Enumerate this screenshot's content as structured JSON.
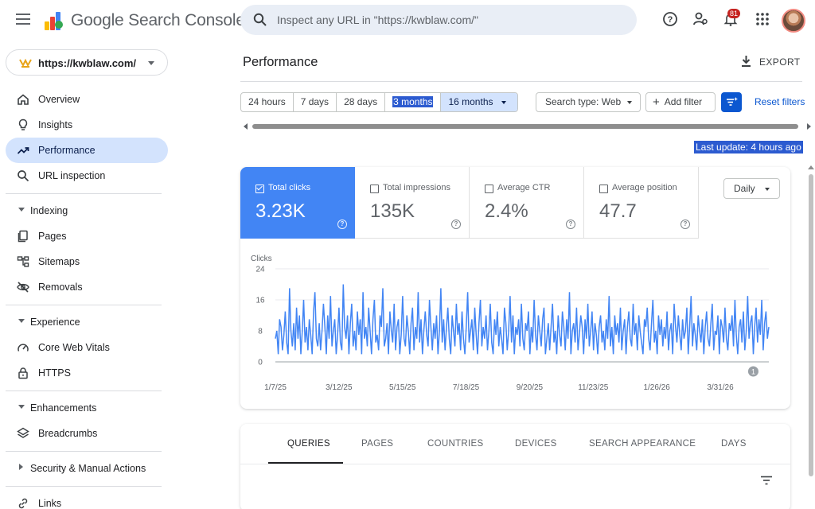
{
  "app": {
    "brand_google": "Google",
    "brand_product": "Search Console"
  },
  "search": {
    "placeholder": "Inspect any URL in \"https://kwblaw.com/\""
  },
  "header": {
    "notification_count": "81"
  },
  "property": {
    "label": "https://kwblaw.com/"
  },
  "sidebar": {
    "items": [
      {
        "label": "Overview",
        "icon": "home-icon"
      },
      {
        "label": "Insights",
        "icon": "lightbulb-icon"
      },
      {
        "label": "Performance",
        "icon": "trending-up-icon",
        "active": true
      },
      {
        "label": "URL inspection",
        "icon": "search-icon"
      }
    ],
    "sections": [
      {
        "label": "Indexing",
        "expanded": true,
        "items": [
          {
            "label": "Pages",
            "icon": "pages-icon"
          },
          {
            "label": "Sitemaps",
            "icon": "sitemap-icon"
          },
          {
            "label": "Removals",
            "icon": "eye-off-icon"
          }
        ]
      },
      {
        "label": "Experience",
        "expanded": true,
        "items": [
          {
            "label": "Core Web Vitals",
            "icon": "speedometer-icon"
          },
          {
            "label": "HTTPS",
            "icon": "lock-icon"
          }
        ]
      },
      {
        "label": "Enhancements",
        "expanded": true,
        "items": [
          {
            "label": "Breadcrumbs",
            "icon": "layers-icon"
          }
        ]
      },
      {
        "label": "Security & Manual Actions",
        "expanded": false,
        "items": []
      }
    ],
    "links": {
      "label": "Links",
      "icon": "link-icon"
    }
  },
  "main": {
    "title": "Performance",
    "export_label": "EXPORT",
    "ranges": [
      "24 hours",
      "7 days",
      "28 days",
      "3 months",
      "16 months"
    ],
    "range_selected": "16 months",
    "search_type": "Search type: Web",
    "add_filter": "Add filter",
    "reset_filters": "Reset filters",
    "last_update": "Last update: 4 hours ago"
  },
  "metrics": [
    {
      "label": "Total clicks",
      "value": "3.23K",
      "checked": true
    },
    {
      "label": "Total impressions",
      "value": "135K",
      "checked": false
    },
    {
      "label": "Average CTR",
      "value": "2.4%",
      "checked": false
    },
    {
      "label": "Average position",
      "value": "47.7",
      "checked": false
    }
  ],
  "granularity": "Daily",
  "colors": {
    "accent": "#4285f4",
    "selected_bg": "#d3e3fd",
    "link": "#0b57d0"
  },
  "chart_data": {
    "type": "line",
    "ylabel": "Clicks",
    "yticks": [
      "24",
      "16",
      "8",
      "0"
    ],
    "ylim": [
      0,
      24
    ],
    "xticks": [
      "1/7/25",
      "3/12/25",
      "5/15/25",
      "7/18/25",
      "9/20/25",
      "11/23/25",
      "1/26/26",
      "3/31/26"
    ],
    "annotation": "1",
    "series": [
      {
        "color": "#4285f4",
        "values": [
          6,
          8,
          2,
          11,
          9,
          3,
          7,
          13,
          5,
          2,
          19,
          8,
          4,
          10,
          3,
          14,
          6,
          12,
          2,
          8,
          16,
          5,
          9,
          3,
          11,
          7,
          2,
          13,
          18,
          6,
          4,
          10,
          3,
          8,
          15,
          9,
          2,
          12,
          6,
          17,
          4,
          8,
          11,
          2,
          7,
          14,
          5,
          3,
          20,
          9,
          6,
          12,
          2,
          10,
          15,
          4,
          8,
          3,
          13,
          7,
          11,
          2,
          18,
          6,
          9,
          4,
          14,
          8,
          2,
          11,
          16,
          5,
          7,
          3,
          12,
          9,
          19,
          4,
          6,
          10,
          2,
          13,
          8,
          5,
          15,
          3,
          9,
          11,
          2,
          7,
          17,
          6,
          4,
          12,
          8,
          2,
          10,
          14,
          3,
          9,
          6,
          18,
          5,
          11,
          2,
          8,
          13,
          7,
          4,
          16,
          9,
          3,
          10,
          6,
          12,
          2,
          8,
          19,
          5,
          11,
          3,
          9,
          14,
          6,
          2,
          12,
          8,
          4,
          15,
          7,
          10,
          3,
          13,
          6,
          2,
          9,
          18,
          5,
          8,
          11,
          3,
          14,
          7,
          2,
          10,
          16,
          4,
          9,
          6,
          12,
          3,
          8,
          15,
          5,
          2,
          11,
          7,
          13,
          4,
          9,
          6,
          2,
          14,
          10,
          3,
          8,
          17,
          5,
          12,
          2,
          9,
          7,
          11,
          4,
          15,
          6,
          3,
          10,
          8,
          13,
          2,
          9,
          5,
          16,
          7,
          3,
          12,
          8,
          4,
          11,
          14,
          2,
          6,
          10,
          3,
          9,
          15,
          5,
          8,
          2,
          12,
          7,
          4,
          13,
          9,
          3,
          11,
          6,
          18,
          2,
          8,
          10,
          5,
          14,
          3,
          7,
          12,
          9,
          2,
          11,
          6,
          15,
          4,
          8,
          13,
          3,
          10,
          7,
          2,
          9,
          12,
          5,
          8,
          3,
          11,
          6,
          17,
          4,
          9,
          2,
          12,
          7,
          10,
          5,
          14,
          3,
          8,
          11,
          2,
          9,
          13,
          6,
          4,
          15,
          7,
          10,
          3,
          12,
          8,
          5,
          2,
          11,
          9,
          14,
          6,
          3,
          10,
          16,
          5,
          8,
          2,
          12,
          7,
          11,
          4,
          9,
          6,
          13,
          3,
          8,
          10,
          2,
          15,
          9,
          5,
          12,
          7,
          3,
          11,
          6,
          8,
          14,
          2,
          9,
          17,
          4,
          10,
          7,
          3,
          12,
          8,
          5,
          11,
          2,
          9,
          13,
          6,
          4,
          10,
          15,
          3,
          8,
          7,
          12,
          2,
          11,
          9,
          5,
          14,
          6,
          3,
          10,
          8,
          12,
          4,
          16,
          7,
          2,
          9,
          11,
          5,
          13,
          3,
          8,
          17,
          6,
          10,
          12,
          2,
          9,
          14,
          5,
          11,
          7,
          16,
          3,
          10,
          13,
          6,
          9
        ]
      }
    ]
  }
}
